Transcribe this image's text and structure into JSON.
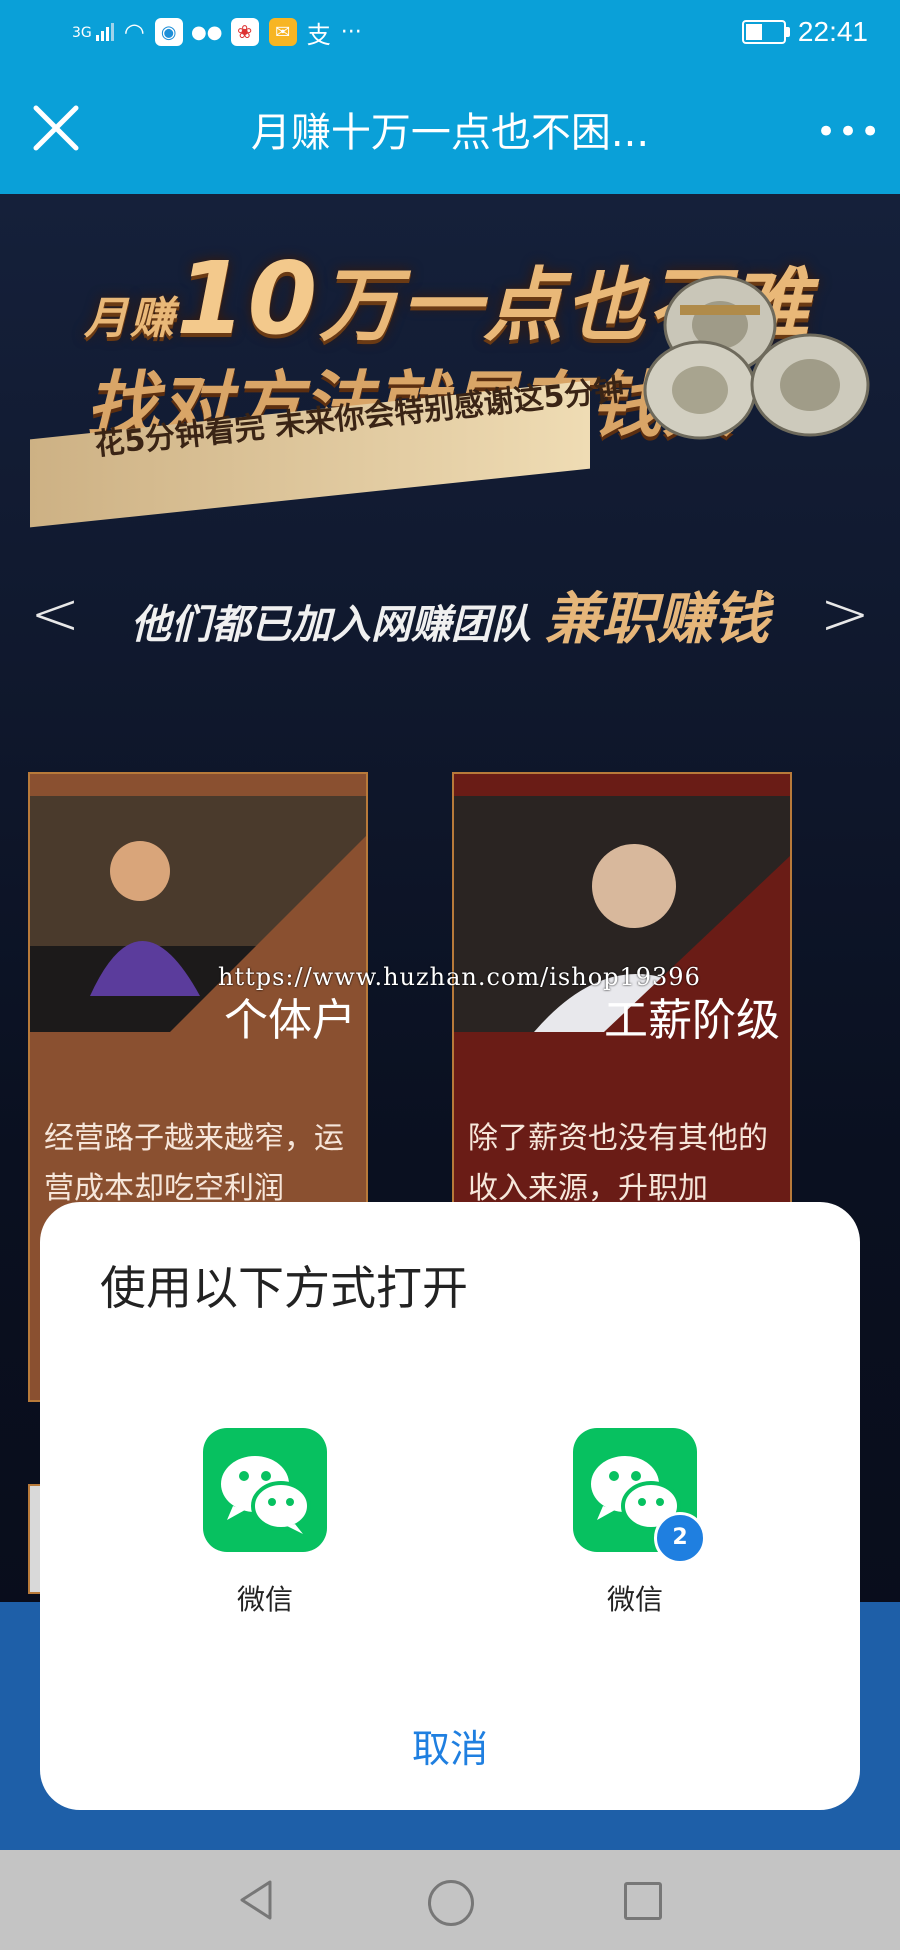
{
  "status_bar": {
    "network": "3G",
    "app_icons": [
      "app-icon-1",
      "wechat-icon",
      "app-icon-3",
      "mail-icon"
    ],
    "alipay_glyph": "支",
    "more": "···",
    "time": "22:41"
  },
  "header": {
    "title": "月赚十万一点也不困...",
    "more": "•••"
  },
  "banner": {
    "line1_prefix": "月赚",
    "line1_num": "10",
    "line1_suffix": "万一点也不难",
    "line2": "找对方法就是有钱人",
    "ribbon": "花5分钟看完 未来你会特别感谢这5分钟"
  },
  "subhead": {
    "left_chevron": "<",
    "text": "他们都已加入网赚团队",
    "highlight": "兼职赚钱",
    "right_chevron": ">"
  },
  "cards": [
    {
      "title": "个体户",
      "desc": "经营路子越来越窄，运营成本却吃空利润"
    },
    {
      "title": "工薪阶级",
      "desc": "除了薪资也没有其他的收入来源，升职加"
    }
  ],
  "watermark": "https://www.huzhan.com/ishop19396",
  "sheet": {
    "title": "使用以下方式打开",
    "apps": [
      {
        "label": "微信",
        "icon": "wechat-icon"
      },
      {
        "label": "微信",
        "icon": "wechat-icon",
        "badge": "2"
      }
    ],
    "cancel": "取消"
  },
  "colors": {
    "accent_blue": "#0aa0d8",
    "wechat_green": "#07c160",
    "cancel_blue": "#1f7fe0"
  }
}
